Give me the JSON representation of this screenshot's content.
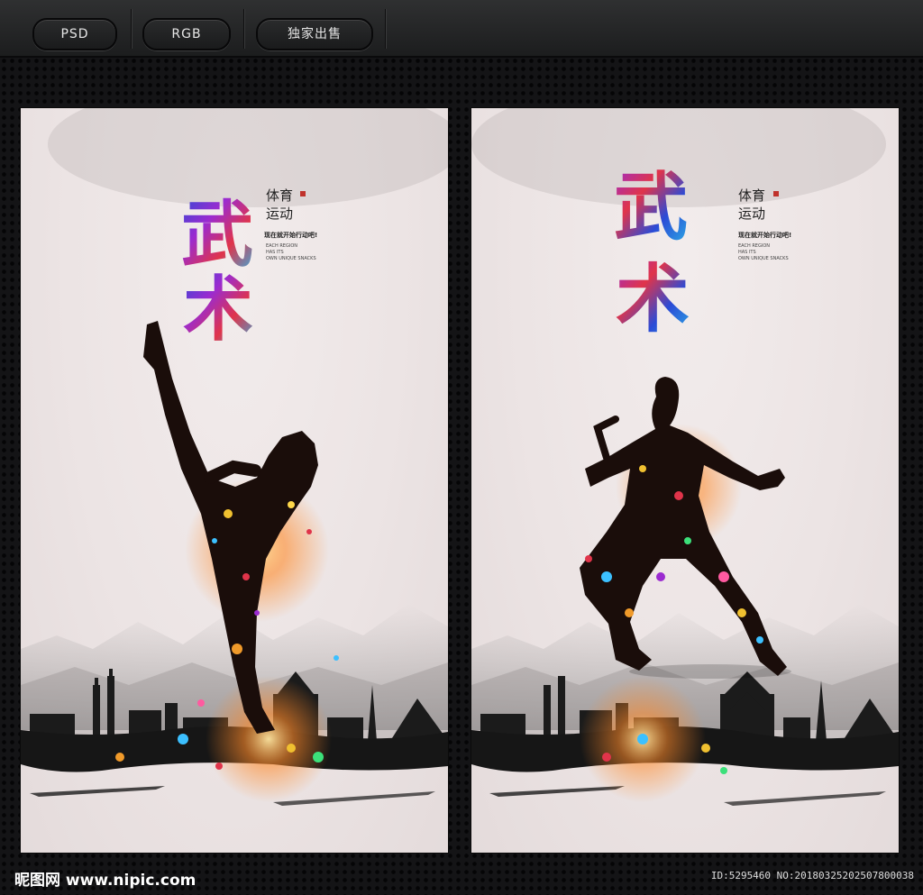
{
  "toolbar": {
    "buttons": [
      {
        "label": "PSD"
      },
      {
        "label": "RGB"
      },
      {
        "label": "独家出售"
      }
    ]
  },
  "posters": [
    {
      "title_char_1": "武",
      "title_char_2": "术",
      "subtitle_line_1": "体育",
      "subtitle_line_2": "运动",
      "slogan": "现在就开始行动吧!",
      "english_text": "EACH REGION\nHAS ITS\nOWN UNIQUE SNACKS"
    },
    {
      "title_char_1": "武",
      "title_char_2": "术",
      "subtitle_line_1": "体育",
      "subtitle_line_2": "运动",
      "slogan": "现在就开始行动吧!",
      "english_text": "EACH REGION\nHAS ITS\nOWN UNIQUE SNACKS"
    }
  ],
  "footer": {
    "logo": "昵图网 www.nipic.com",
    "image_id": "ID:5295460 NO:20180325202507800038"
  },
  "colors": {
    "frame_bg": "#141416",
    "poster_bg": "#ece4e4",
    "silhouette": "#1a0d0a",
    "glow": "#ff9a2e",
    "title_gradient": [
      "#2b4bd6",
      "#9b2bd0",
      "#e0344a",
      "#f09a2a"
    ]
  },
  "icons": {
    "logo_mark": "nipic-logo-icon"
  }
}
